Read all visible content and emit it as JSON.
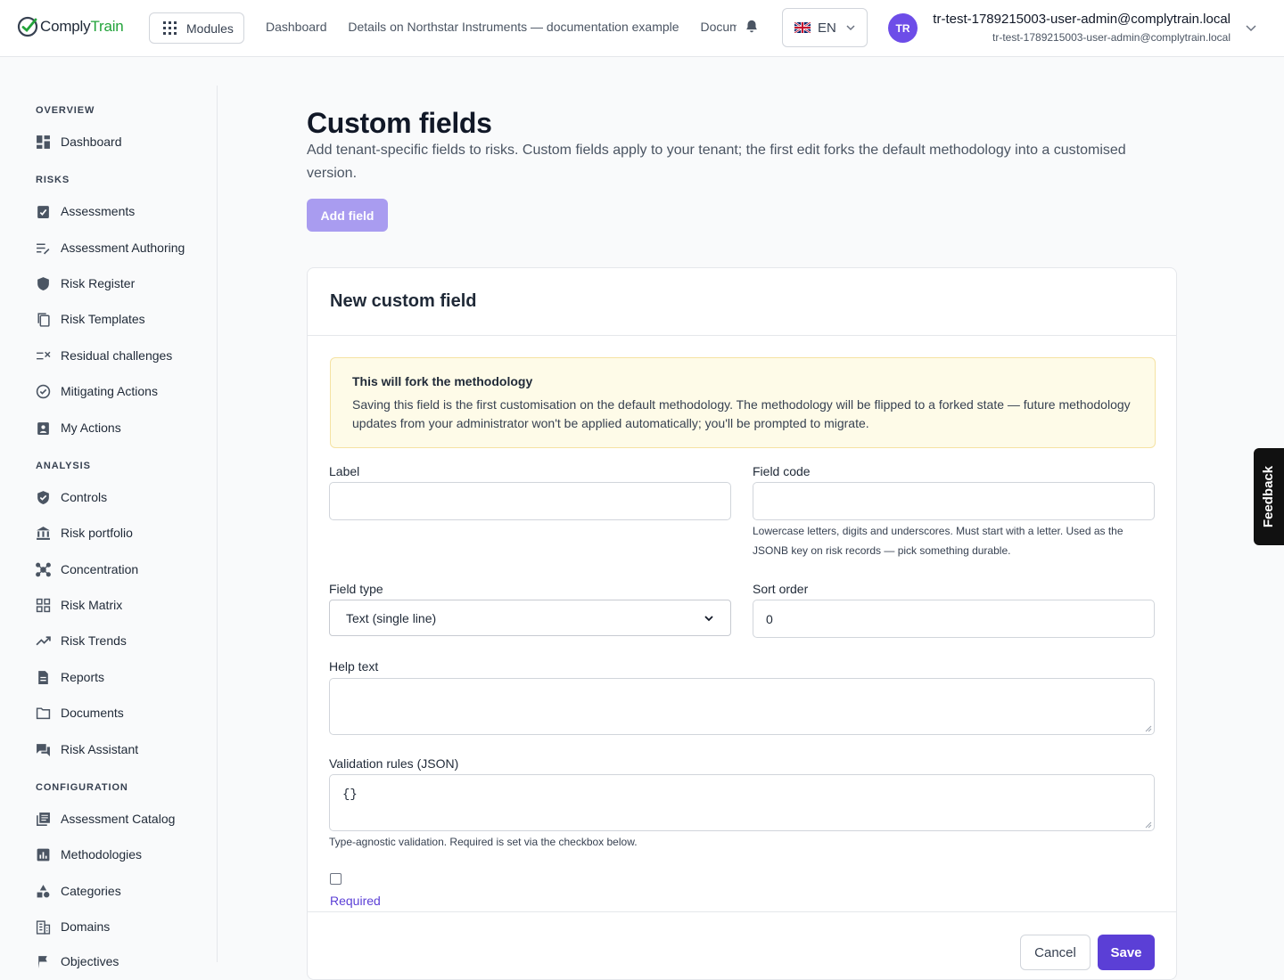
{
  "header": {
    "logo_text_1": "Comply",
    "logo_text_2": "Train",
    "modules_label": "Modules",
    "nav": [
      "Dashboard",
      "Details on Northstar Instruments — documentation example",
      "Documentation"
    ],
    "language": "EN",
    "avatar_initials": "TR",
    "user_name": "tr-test-1789215003-user-admin@complytrain.local",
    "user_email": "tr-test-1789215003-user-admin@complytrain.local"
  },
  "sidebar": {
    "sections": {
      "overview": "OVERVIEW",
      "risks": "RISKS",
      "analysis": "ANALYSIS",
      "configuration": "CONFIGURATION"
    },
    "items": {
      "dashboard": "Dashboard",
      "assessments": "Assessments",
      "assessment_authoring": "Assessment Authoring",
      "risk_register": "Risk Register",
      "risk_templates": "Risk Templates",
      "residual_challenges": "Residual challenges",
      "mitigating_actions": "Mitigating Actions",
      "my_actions": "My Actions",
      "controls": "Controls",
      "risk_portfolio": "Risk portfolio",
      "concentration": "Concentration",
      "risk_matrix": "Risk Matrix",
      "risk_trends": "Risk Trends",
      "reports": "Reports",
      "documents": "Documents",
      "risk_assistant": "Risk Assistant",
      "assessment_catalog": "Assessment Catalog",
      "methodologies": "Methodologies",
      "categories": "Categories",
      "domains": "Domains",
      "objectives": "Objectives"
    }
  },
  "main": {
    "title": "Custom fields",
    "description": "Add tenant-specific fields to risks. Custom fields apply to your tenant; the first edit forks the default methodology into a customised version.",
    "add_field_label": "Add field"
  },
  "form": {
    "title": "New custom field",
    "warning_title": "This will fork the methodology",
    "warning_text": "Saving this field is the first customisation on the default methodology. The methodology will be flipped to a forked state — future methodology updates from your administrator won't be applied automatically; you'll be prompted to migrate.",
    "label_label": "Label",
    "label_value": "",
    "field_code_label": "Field code",
    "field_code_value": "",
    "field_code_hint": "Lowercase letters, digits and underscores. Must start with a letter. Used as the JSONB key on risk records — pick something durable.",
    "field_type_label": "Field type",
    "field_type_value": "Text (single line)",
    "sort_order_label": "Sort order",
    "sort_order_value": "0",
    "help_text_label": "Help text",
    "help_text_value": "",
    "validation_label": "Validation rules (JSON)",
    "validation_value": "{}",
    "validation_hint": "Type-agnostic validation. Required is set via the checkbox below.",
    "required_label": "Required",
    "cancel_label": "Cancel",
    "save_label": "Save"
  },
  "feedback_label": "Feedback",
  "colors": {
    "accent": "#5b3fd6",
    "brand_green": "#22a33a",
    "warning_bg": "#fefbe8"
  }
}
